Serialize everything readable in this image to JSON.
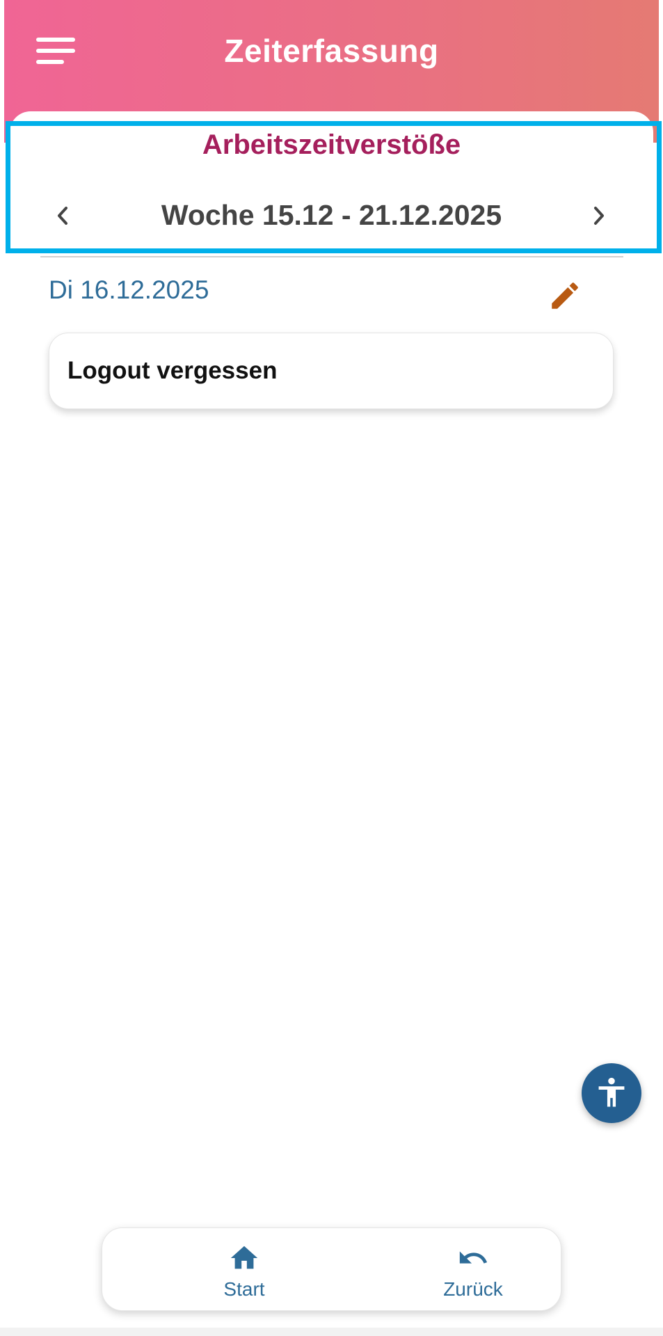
{
  "header": {
    "title": "Zeiterfassung",
    "gradient_start": "#f06595",
    "gradient_end": "#e57a73"
  },
  "section": {
    "title": "Arbeitszeitverstöße",
    "title_color": "#a51f5c"
  },
  "week_nav": {
    "label": "Woche 15.12 - 21.12.2025",
    "prev_icon": "chevron-left-icon",
    "next_icon": "chevron-right-icon"
  },
  "day": {
    "date": "Di 16.12.2025",
    "date_color": "#2e6c98",
    "edit_icon": "pencil-icon",
    "edit_color": "#b85a12",
    "violations": [
      {
        "text": "Logout vergessen"
      }
    ]
  },
  "highlight_color": "#00b0ea",
  "accessibility_button": {
    "icon": "accessibility-icon",
    "color": "#245f91"
  },
  "bottom_nav": {
    "items": [
      {
        "label": "Start",
        "icon": "home-icon"
      },
      {
        "label": "Zurück",
        "icon": "undo-icon"
      }
    ],
    "color": "#2e6c98"
  }
}
